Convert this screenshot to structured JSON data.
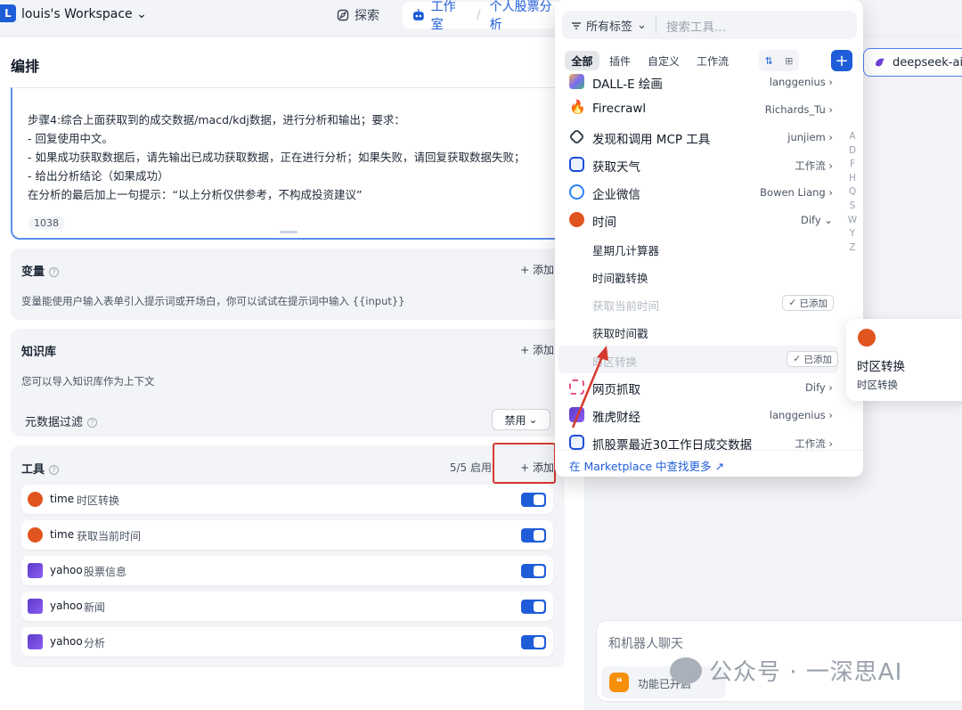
{
  "topbar": {
    "workspace_initial": "L",
    "workspace_name": "louis's Workspace",
    "explore_label": "探索",
    "studio_label": "工作室",
    "breadcrumb_sep": "/",
    "app_name": "个人股票分析"
  },
  "editor": {
    "section_title": "编排",
    "prompt_lines": [
      "步骤4:综合上面获取到的成交数据/macd/kdj数据，进行分析和输出；要求：",
      "- 回复使用中文。",
      "- 如果成功获取数据后，请先输出已成功获取数据，正在进行分析；如果失败，请回复获取数据失败；",
      "- 给出分析结论（如果成功）",
      "在分析的最后加上一句提示：“以上分析仅供参考，不构成投资建议”"
    ],
    "char_count": "1038"
  },
  "variables": {
    "title": "变量",
    "add_label": "+ 添加",
    "description": "变量能使用户输入表单引入提示词或开场白，你可以试试在提示词中输入 {{input}}"
  },
  "knowledge": {
    "title": "知识库",
    "add_label": "+ 添加",
    "description": "您可以导入知识库作为上下文",
    "metadata_filter_label": "元数据过滤",
    "metadata_filter_value": "禁用"
  },
  "tools": {
    "title": "工具",
    "enabled_count": "5/5 启用",
    "add_label": "+ 添加",
    "items": [
      {
        "provider": "time",
        "name": "时区转换",
        "icon": "clock-icon",
        "enabled": true
      },
      {
        "provider": "time",
        "name": "获取当前时间",
        "icon": "clock-icon",
        "enabled": true
      },
      {
        "provider": "yahoo",
        "name": "股票信息",
        "icon": "yahoo-chart-icon",
        "enabled": true
      },
      {
        "provider": "yahoo",
        "name": "新闻",
        "icon": "yahoo-chart-icon",
        "enabled": true
      },
      {
        "provider": "yahoo",
        "name": "分析",
        "icon": "yahoo-chart-icon",
        "enabled": true
      }
    ]
  },
  "model": {
    "name": "deepseek-ai/"
  },
  "chat": {
    "placeholder": "和机器人聊天",
    "feature_label": "功能已开启"
  },
  "watermark": {
    "text": "公众号 · 一深思AI"
  },
  "tool_picker": {
    "tags_label": "所有标签",
    "search_placeholder": "搜索工具...",
    "tabs": [
      "全部",
      "插件",
      "自定义",
      "工作流"
    ],
    "list": [
      {
        "name": "DALL-E 绘画",
        "author": "langgenius",
        "icon": "dalle-icon",
        "color": "#7c6cf2"
      },
      {
        "name": "Firecrawl",
        "author": "Richards_Tu",
        "icon": "fire-icon",
        "color": "#f97316"
      },
      {
        "name": "发现和调用 MCP 工具",
        "author": "junjiem",
        "icon": "mcp-icon",
        "color": "#374151"
      },
      {
        "name": "获取天气",
        "author": "工作流",
        "icon": "robot-icon",
        "color": "#1d4ed8"
      },
      {
        "name": "企业微信",
        "author": "Bowen Liang",
        "icon": "wecom-icon",
        "color": "#2b82f6"
      },
      {
        "name": "时间",
        "author": "Dify",
        "icon": "clock-icon",
        "color": "#e0541f"
      }
    ],
    "time_tools": [
      {
        "name": "星期几计算器",
        "added": false
      },
      {
        "name": "时间戳转换",
        "added": false
      },
      {
        "name": "获取当前时间",
        "added": true
      },
      {
        "name": "获取时间戳",
        "added": false
      },
      {
        "name": "时区转换",
        "added": true
      }
    ],
    "added_label": "已添加",
    "list_after": [
      {
        "name": "网页抓取",
        "author": "Dify",
        "icon": "spider-icon",
        "color": "#e44e8a"
      },
      {
        "name": "雅虎财经",
        "author": "langgenius",
        "icon": "yahoo-chart-icon",
        "color": "#6d3fd6"
      },
      {
        "name": "抓股票最近30工作日成交数据",
        "author": "工作流",
        "icon": "robot-icon",
        "color": "#1d4ed8"
      }
    ],
    "alphabet": [
      "A",
      "D",
      "F",
      "H",
      "Q",
      "S",
      "W",
      "Y",
      "Z"
    ],
    "marketplace_link": "在 Marketplace 中查找更多 ↗"
  },
  "tooltip": {
    "title": "时区转换",
    "subtitle": "时区转换"
  },
  "colors": {
    "accent": "#1f5dd8",
    "highlight_red": "#d63a2f",
    "clock_orange": "#e0541f"
  }
}
